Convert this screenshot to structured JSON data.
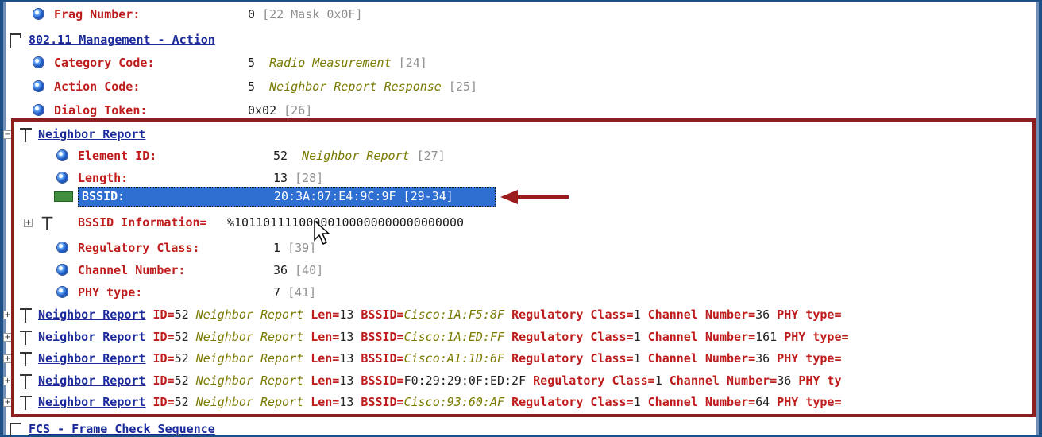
{
  "rows": {
    "frag": {
      "label": "Frag Number:",
      "value": "0",
      "ref": "[22 Mask 0x0F]"
    },
    "mgmt": {
      "label": "802.11 Management - Action"
    },
    "category": {
      "label": "Category Code:",
      "value": "5",
      "desc": "Radio Measurement",
      "ref": "[24]"
    },
    "action": {
      "label": "Action Code:",
      "value": "5",
      "desc": "Neighbor Report Response",
      "ref": "[25]"
    },
    "dialog": {
      "label": "Dialog Token:",
      "value": "0x02",
      "ref": "[26]"
    },
    "nr": {
      "label": "Neighbor Report"
    },
    "element": {
      "label": "Element ID:",
      "value": "52",
      "desc": "Neighbor Report",
      "ref": "[27]"
    },
    "length": {
      "label": "Length:",
      "value": "13",
      "ref": "[28]"
    },
    "bssid": {
      "label": "BSSID:",
      "value": "20:3A:07:E4:9C:9F [29-34]"
    },
    "bssid_info": {
      "label": "BSSID Information=",
      "value": "%10110111100000100000000000000000"
    },
    "regclass": {
      "label": "Regulatory Class:",
      "value": "1",
      "ref": "[39]"
    },
    "channel": {
      "label": "Channel Number:",
      "value": "36",
      "ref": "[40]"
    },
    "phy": {
      "label": "PHY type:",
      "value": "7",
      "ref": "[41]"
    },
    "fcs": {
      "label": "FCS - Frame Check Sequence"
    }
  },
  "neighbors": [
    {
      "name": "Neighbor Report",
      "id_label": "ID=",
      "id": "52",
      "id_desc": "Neighbor Report",
      "len_label": "Len=",
      "len": "13",
      "bssid_label": "BSSID=",
      "bssid": "Cisco:1A:F5:8F",
      "bssid_italic": true,
      "reg": "Regulatory Class=",
      "reg_val": "1",
      "ch": "Channel Number=",
      "ch_val": "36",
      "phy": "PHY type="
    },
    {
      "name": "Neighbor Report",
      "id_label": "ID=",
      "id": "52",
      "id_desc": "Neighbor Report",
      "len_label": "Len=",
      "len": "13",
      "bssid_label": "BSSID=",
      "bssid": "Cisco:1A:ED:FF",
      "bssid_italic": true,
      "reg": "Regulatory Class=",
      "reg_val": "1",
      "ch": "Channel Number=",
      "ch_val": "161",
      "phy": "PHY type="
    },
    {
      "name": "Neighbor Report",
      "id_label": "ID=",
      "id": "52",
      "id_desc": "Neighbor Report",
      "len_label": "Len=",
      "len": "13",
      "bssid_label": "BSSID=",
      "bssid": "Cisco:A1:1D:6F",
      "bssid_italic": true,
      "reg": "Regulatory Class=",
      "reg_val": "1",
      "ch": "Channel Number=",
      "ch_val": "36",
      "phy": "PHY type="
    },
    {
      "name": "Neighbor Report",
      "id_label": "ID=",
      "id": "52",
      "id_desc": "Neighbor Report",
      "len_label": "Len=",
      "len": "13",
      "bssid_label": "BSSID=",
      "bssid": "F0:29:29:0F:ED:2F",
      "bssid_italic": false,
      "reg": "Regulatory Class=",
      "reg_val": "1",
      "ch": "Channel Number=",
      "ch_val": "36",
      "phy": "PHY ty"
    },
    {
      "name": "Neighbor Report",
      "id_label": "ID=",
      "id": "52",
      "id_desc": "Neighbor Report",
      "len_label": "Len=",
      "len": "13",
      "bssid_label": "BSSID=",
      "bssid": "Cisco:93:60:AF",
      "bssid_italic": true,
      "reg": "Regulatory Class=",
      "reg_val": "1",
      "ch": "Channel Number=",
      "ch_val": "64",
      "phy": "PHY type="
    }
  ],
  "colors": {
    "label_red": "#bf1d1d",
    "link_blue": "#1b2a9b",
    "selection": "#2f6fd1",
    "annotation": "#8b1e1e"
  }
}
